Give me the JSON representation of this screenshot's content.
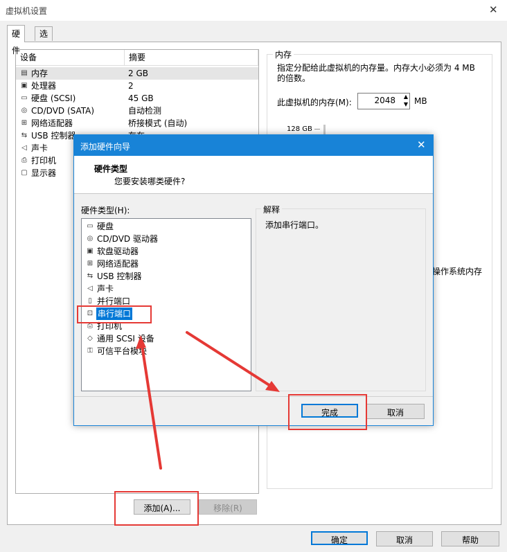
{
  "window": {
    "title": "虚拟机设置"
  },
  "tabs": [
    {
      "label": "硬件"
    },
    {
      "label": "选项"
    }
  ],
  "device_list": {
    "col_device": "设备",
    "col_summary": "摘要",
    "rows": [
      {
        "name": "内存",
        "summary": "2 GB",
        "icon": "memory-icon"
      },
      {
        "name": "处理器",
        "summary": "2",
        "icon": "cpu-icon"
      },
      {
        "name": "硬盘 (SCSI)",
        "summary": "45 GB",
        "icon": "harddisk-icon"
      },
      {
        "name": "CD/DVD (SATA)",
        "summary": "自动检测",
        "icon": "cdrom-icon"
      },
      {
        "name": "网络适配器",
        "summary": "桥接模式 (自动)",
        "icon": "network-icon"
      },
      {
        "name": "USB 控制器",
        "summary": "存在",
        "icon": "usb-icon"
      },
      {
        "name": "声卡",
        "summary": "",
        "icon": "speaker-icon"
      },
      {
        "name": "打印机",
        "summary": "",
        "icon": "printer-icon"
      },
      {
        "name": "显示器",
        "summary": "",
        "icon": "monitor-icon"
      }
    ]
  },
  "memory": {
    "group_label": "内存",
    "description": "指定分配给此虚拟机的内存量。内存大小必须为 4 MB 的倍数。",
    "field_label": "此虚拟机的内存(M):",
    "value": "2048",
    "unit": "MB",
    "scale_top": "128 GB",
    "os_memory_fragment": "操作系统内存"
  },
  "buttons": {
    "add": "添加(A)...",
    "remove": "移除(R)",
    "ok": "确定",
    "cancel": "取消",
    "help": "帮助"
  },
  "wizard": {
    "title": "添加硬件向导",
    "header_title": "硬件类型",
    "header_subtitle": "您要安装哪类硬件?",
    "list_label": "硬件类型(H):",
    "items": [
      {
        "name": "硬盘",
        "icon": "harddisk-icon"
      },
      {
        "name": "CD/DVD 驱动器",
        "icon": "cdrom-icon"
      },
      {
        "name": "软盘驱动器",
        "icon": "floppy-icon"
      },
      {
        "name": "网络适配器",
        "icon": "network-icon"
      },
      {
        "name": "USB 控制器",
        "icon": "usb-icon"
      },
      {
        "name": "声卡",
        "icon": "speaker-icon"
      },
      {
        "name": "并行端口",
        "icon": "parallel-port-icon"
      },
      {
        "name": "串行端口",
        "icon": "serial-port-icon"
      },
      {
        "name": "打印机",
        "icon": "printer-icon"
      },
      {
        "name": "通用 SCSI 设备",
        "icon": "scsi-icon"
      },
      {
        "name": "可信平台模块",
        "icon": "tpm-icon"
      }
    ],
    "selected_index": 7,
    "explanation_label": "解释",
    "explanation_text": "添加串行端口。",
    "finish": "完成",
    "cancel": "取消"
  },
  "colors": {
    "accent": "#0078d7",
    "title_blue": "#1883d7",
    "annotation_red": "#e53935"
  }
}
